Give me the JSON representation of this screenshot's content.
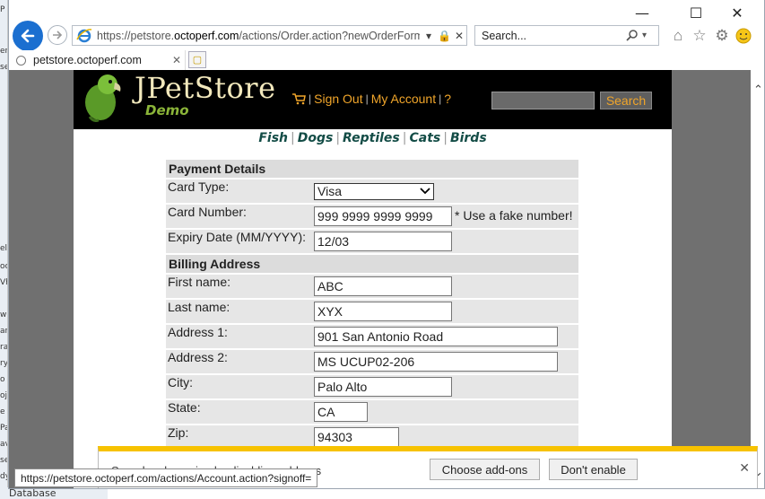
{
  "browser": {
    "address_url_prefix": "https://petstore.",
    "address_url_domain": "octoperf.com",
    "address_url_path": "/actions/Order.action?newOrderForm=",
    "search_placeholder": "Search...",
    "tab_label": "petstore.octoperf.com",
    "status_url": "https://petstore.octoperf.com/actions/Account.action?signoff="
  },
  "header": {
    "logo_title": "JPetStore",
    "logo_subtitle": "Demo",
    "sign_out": "Sign Out",
    "my_account": "My Account",
    "help": "?",
    "separator": "|",
    "search_button": "Search"
  },
  "quicklinks": [
    "Fish",
    "Dogs",
    "Reptiles",
    "Cats",
    "Birds"
  ],
  "payment": {
    "section_title": "Payment Details",
    "card_type_label": "Card Type:",
    "card_type_value": "Visa",
    "card_number_label": "Card Number:",
    "card_number_value": "999 9999 9999 9999",
    "card_number_note": "* Use a fake number!",
    "expiry_label": "Expiry Date (MM/YYYY):",
    "expiry_value": "12/03"
  },
  "billing": {
    "section_title": "Billing Address",
    "first_name_label": "First name:",
    "first_name_value": "ABC",
    "last_name_label": "Last name:",
    "last_name_value": "XYX",
    "address1_label": "Address 1:",
    "address1_value": "901 San Antonio Road",
    "address2_label": "Address 2:",
    "address2_value": "MS UCUP02-206",
    "city_label": "City:",
    "city_value": "Palo Alto",
    "state_label": "State:",
    "state_value": "CA",
    "zip_label": "Zip:",
    "zip_value": "94303"
  },
  "notification": {
    "partial_text": "Speed up browsing by disabling add-ons",
    "choose_addons": "Choose add-ons",
    "dont_enable": "Don't enable"
  },
  "background_window": {
    "bottom_label": "Database"
  },
  "colors": {
    "header_bg": "#000000",
    "link_orange": "#f0a52a",
    "notification_accent": "#f7c200",
    "browser_back_blue": "#1b6fd0"
  }
}
